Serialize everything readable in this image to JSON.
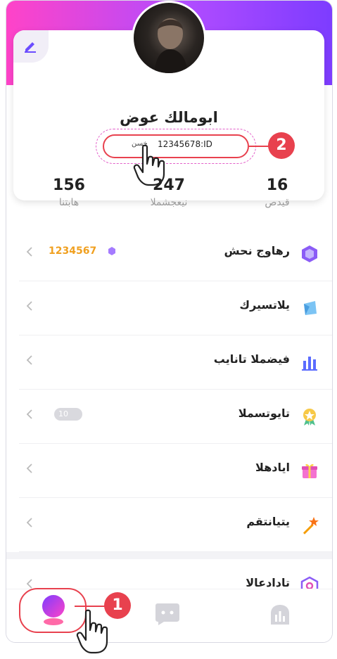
{
  "profile": {
    "name": "ابومالك عوض",
    "id_text": "12345678:ID",
    "copy_label": "خسن",
    "stats": [
      {
        "value": "156",
        "label": "هابتنا"
      },
      {
        "value": "247",
        "label": "نيعجشملا"
      },
      {
        "value": "16",
        "label": "قيدص"
      }
    ]
  },
  "annotations": {
    "step1": "1",
    "step2": "2"
  },
  "menu": [
    {
      "label": "رهاوج نحش",
      "icon": "gem-icon",
      "value": "1234567"
    },
    {
      "label": "يلاتسيرك",
      "icon": "crystal-icon"
    },
    {
      "label": "فيضملا تانايب",
      "icon": "bar-chart-icon"
    },
    {
      "label": "تايوتسملا",
      "icon": "medal-icon",
      "badge": "10"
    },
    {
      "label": "ايادهلا",
      "icon": "gift-icon"
    },
    {
      "label": "يتيانتقم",
      "icon": "magic-wand-icon"
    },
    {
      "label": "تادادعالا",
      "icon": "settings-hex-icon"
    }
  ],
  "colors": {
    "accent": "#b14cff",
    "annotation": "#e8414e",
    "value": "#f0a020"
  }
}
